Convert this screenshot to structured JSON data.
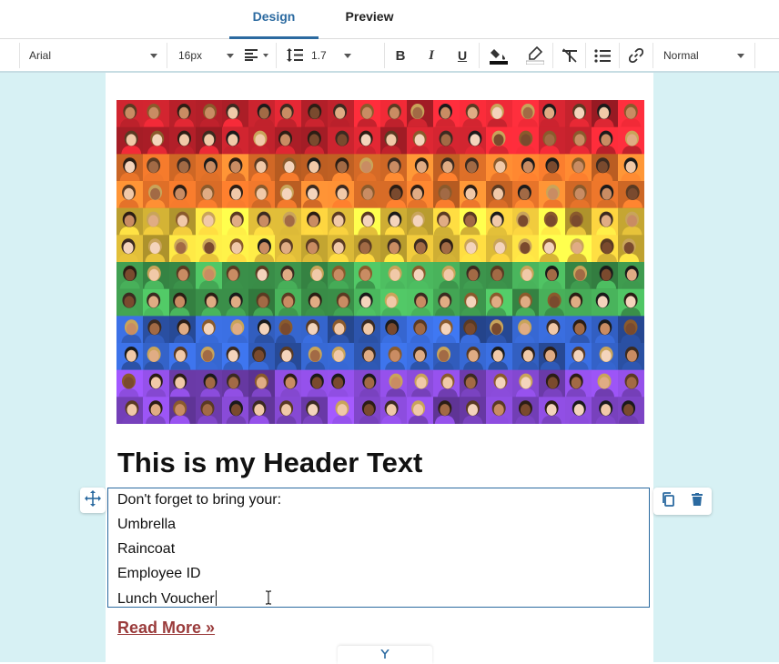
{
  "tabs": [
    {
      "label": "Design",
      "active": true
    },
    {
      "label": "Preview",
      "active": false
    }
  ],
  "toolbar": {
    "font_family": "Arial",
    "font_size": "16px",
    "line_height": "1.7",
    "paragraph_style": "Normal",
    "icons": [
      "align-left-icon",
      "line-height-icon",
      "bold-icon",
      "italic-icon",
      "underline-icon",
      "text-color-icon",
      "highlight-icon",
      "clear-format-icon",
      "bullet-list-icon",
      "link-icon"
    ]
  },
  "content": {
    "header": "This is my Header Text",
    "lines": [
      "Don't forget to bring your:",
      "Umbrella",
      "Raincoat",
      "Employee ID",
      "Lunch Voucher"
    ],
    "read_more": "Read More »"
  },
  "colors": {
    "accent": "#2b6aa0",
    "canvas_bg": "#d7f1f4",
    "link": "#9a3b3b"
  },
  "hero_image": {
    "description_icon": "photo-mosaic-image",
    "row_colors": [
      "#c8232e",
      "#e8742a",
      "#e6c23a",
      "#3f9b4f",
      "#2f59b5",
      "#7b43c2"
    ]
  }
}
